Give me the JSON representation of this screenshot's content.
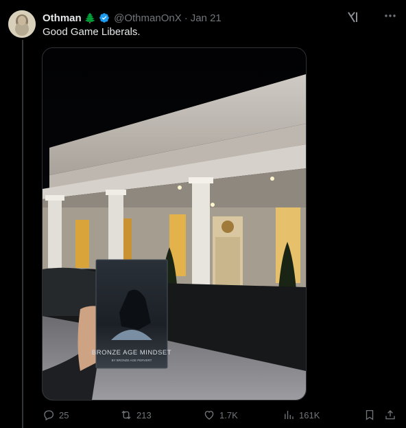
{
  "author": {
    "name": "Othman",
    "badge_emoji": "🌲",
    "handle": "@OthmanOnX",
    "separator": "·",
    "date": "Jan 21"
  },
  "tweet": {
    "text": "Good Game Liberals."
  },
  "media": {
    "book_title": "BRONZE AGE MINDSET",
    "book_author": "BY BRONZE AGE PERVERT"
  },
  "actions": {
    "replies": "25",
    "reposts": "213",
    "likes": "1.7K",
    "views": "161K"
  },
  "colors": {
    "background": "#000000",
    "text": "#e7e9ea",
    "muted": "#71767b",
    "verified": "#1d9bf0"
  }
}
